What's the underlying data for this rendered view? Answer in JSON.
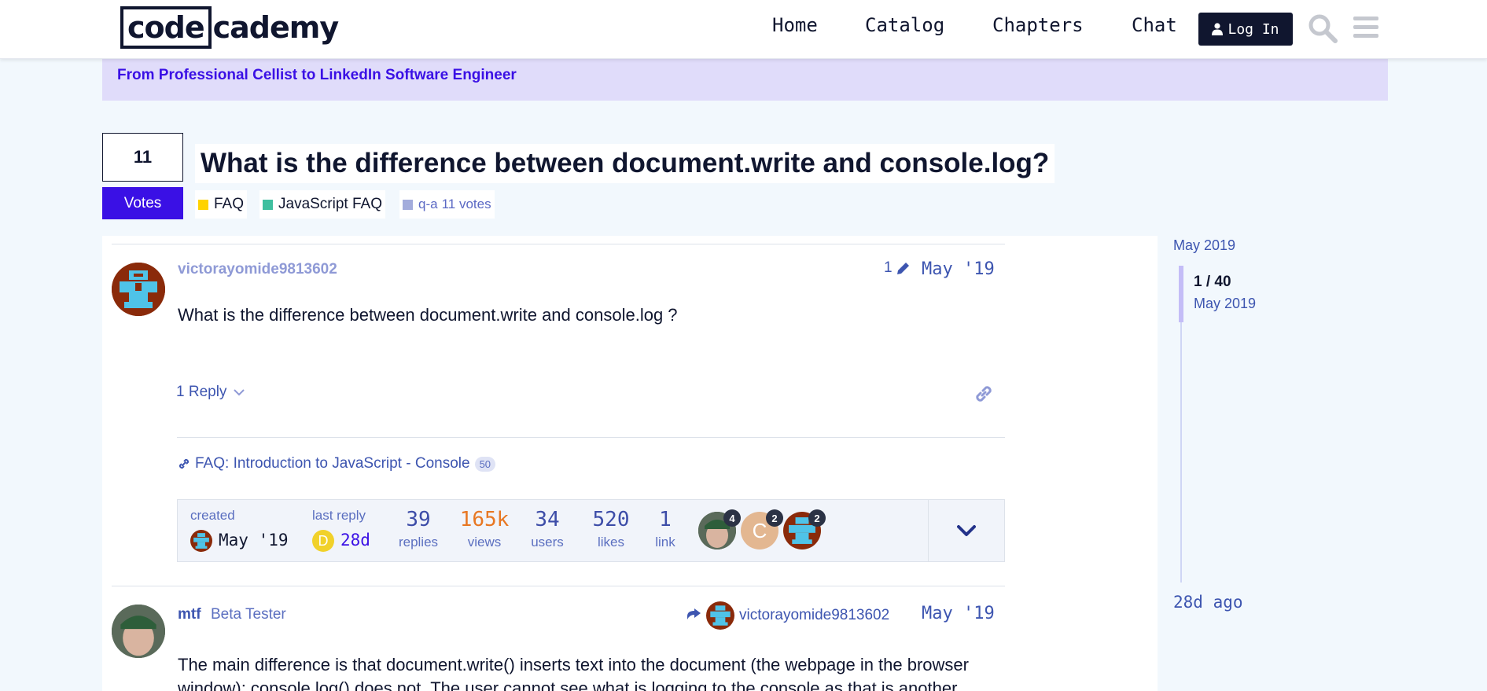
{
  "header": {
    "logo_boxed": "code",
    "logo_rest": "cademy",
    "nav": [
      "Home",
      "Catalog",
      "Chapters",
      "Chat"
    ],
    "login_label": "Log In",
    "search_icon": "search-icon",
    "menu_icon": "hamburger-menu-icon"
  },
  "banner": {
    "link_text": "From Professional Cellist to LinkedIn Software Engineer"
  },
  "topic": {
    "votes_count": "11",
    "votes_label": "Votes",
    "title": "What is the difference between document.write and console.log?",
    "tags": [
      {
        "label": "FAQ",
        "color": "#ffd300"
      },
      {
        "label": "JavaScript FAQ",
        "color": "#3fbf9f"
      },
      {
        "label": "q-a",
        "extra": "11 votes",
        "color": "#a3acdc"
      }
    ]
  },
  "first_post": {
    "username": "victorayomide9813602",
    "edit_count": "1",
    "date": "May '19",
    "body": "What is the difference between document.write and console.log ?",
    "replies_label": "1 Reply",
    "link_title": "FAQ: Introduction to JavaScript - Console",
    "link_clicks": "50"
  },
  "topic_map": {
    "created_label": "created",
    "created_date": "May '19",
    "last_reply_label": "last reply",
    "last_reply_avatar_letter": "D",
    "last_reply_date": "28d",
    "stats": [
      {
        "number": "39",
        "label": "replies"
      },
      {
        "number": "165k",
        "label": "views",
        "color": "#e87722"
      },
      {
        "number": "34",
        "label": "users"
      },
      {
        "number": "520",
        "label": "likes"
      },
      {
        "number": "1",
        "label": "link"
      }
    ],
    "participants": [
      {
        "count": "4"
      },
      {
        "letter": "C",
        "count": "2"
      },
      {
        "count": "2"
      }
    ]
  },
  "second_post": {
    "username": "mtf",
    "user_title": "Beta Tester",
    "reply_to": "victorayomide9813602",
    "date": "May '19",
    "body_line1": "The main difference is that document.write() inserts text into the document (the webpage in the browser",
    "body_line2": "window); console.log() does not. The user cannot see what is logging to the console as that is another"
  },
  "timeline": {
    "top_date": "May 2019",
    "position": "1 / 40",
    "position_date": "May 2019",
    "bottom_ago": "28d ago"
  }
}
